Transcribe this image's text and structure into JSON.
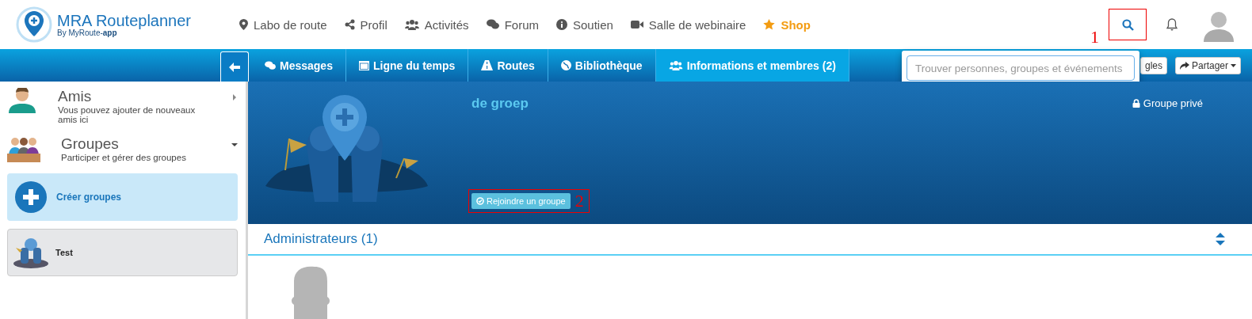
{
  "logo": {
    "title": "MRA Routeplanner",
    "subtitle": "By MyRoute-",
    "subtitle_bold": "app"
  },
  "nav": [
    {
      "label": "Labo de route",
      "featured": false
    },
    {
      "label": "Profil",
      "featured": false
    },
    {
      "label": "Activités",
      "featured": false
    },
    {
      "label": "Forum",
      "featured": false
    },
    {
      "label": "Soutien",
      "featured": false
    },
    {
      "label": "Salle de webinaire",
      "featured": false
    },
    {
      "label": "Shop",
      "featured": true
    }
  ],
  "tabs": [
    {
      "label": "Messages",
      "selected": false
    },
    {
      "label": "Ligne du temps",
      "selected": false
    },
    {
      "label": "Routes",
      "selected": false
    },
    {
      "label": "Bibliothèque",
      "selected": false
    },
    {
      "label": "Informations et membres (2)",
      "selected": true
    }
  ],
  "toolbar_buttons": [
    "gles",
    "Partager"
  ],
  "search": {
    "placeholder": "Trouver personnes, groupes et événements"
  },
  "sidebar": [
    {
      "title": "Amis",
      "subtitle": "Vous pouvez ajouter de nouveaux amis ici",
      "expanded": false
    },
    {
      "title": "Groupes",
      "subtitle": "Participer et gérer des groupes",
      "expanded": true
    }
  ],
  "create_group": "Créer groupes",
  "groups": [
    {
      "name": "Test"
    }
  ],
  "group": {
    "name": "de groep",
    "privacy": "Groupe privé",
    "join": "Rejoindre un groupe"
  },
  "admins": {
    "heading": "Administrateurs (1)"
  },
  "annotations": [
    "1",
    "2"
  ]
}
